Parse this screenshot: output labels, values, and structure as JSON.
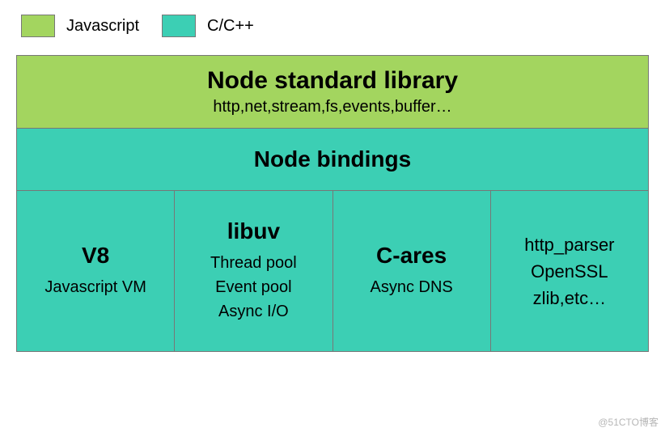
{
  "legend": {
    "js": "Javascript",
    "c": "C/C++"
  },
  "colors": {
    "js": "#a3d55f",
    "c": "#3ccfb4"
  },
  "layers": {
    "stdlib": {
      "title": "Node standard library",
      "subtitle": "http,net,stream,fs,events,buffer…"
    },
    "bindings": {
      "title": "Node bindings"
    }
  },
  "bottom": {
    "v8": {
      "title": "V8",
      "lines": [
        "Javascript VM"
      ]
    },
    "libuv": {
      "title": "libuv",
      "lines": [
        "Thread pool",
        "Event pool",
        "Async I/O"
      ]
    },
    "cares": {
      "title": "C-ares",
      "lines": [
        "Async DNS"
      ]
    },
    "misc": {
      "lines": [
        "http_parser",
        "OpenSSL",
        "zlib,etc…"
      ]
    }
  },
  "watermark": "@51CTO博客"
}
